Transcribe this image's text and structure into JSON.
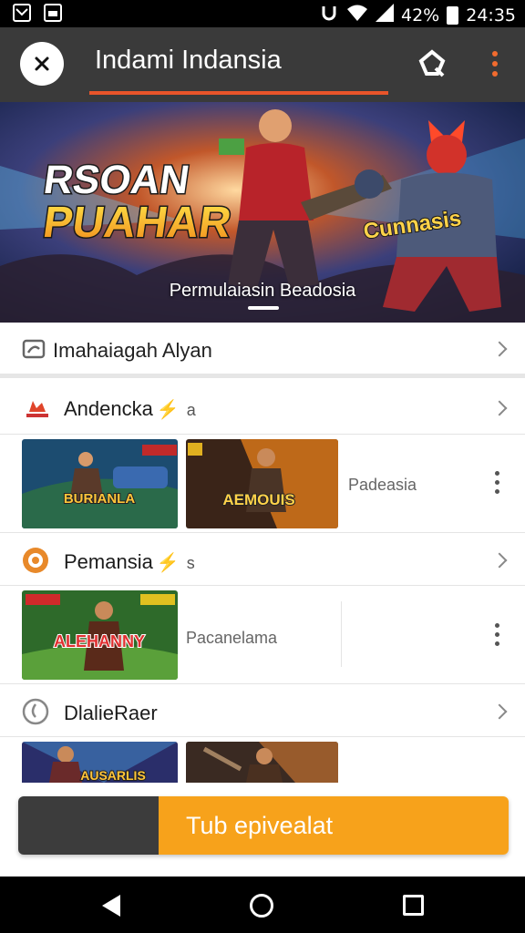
{
  "status_bar": {
    "left_icons": [
      "mail-icon",
      "image-notification-icon"
    ],
    "right_icons": [
      "sync-icon",
      "wifi-icon",
      "signal-icon",
      "battery-icon"
    ],
    "battery": "42%",
    "time": "24:35"
  },
  "app_bar": {
    "title": "Indami Indansia",
    "close_icon": "close-icon",
    "search_icon": "search-icon",
    "more_icon": "more-vertical-icon",
    "accent": "#e8542a"
  },
  "hero": {
    "logo_text_1": "RSOAN",
    "logo_text_2": "PUAHAR",
    "side_text": "Cunnasis",
    "caption": "Permulaiasin Beadosia"
  },
  "first_row": {
    "icon": "gallery-icon",
    "label": "Imahaiagah Alyan"
  },
  "sections": [
    {
      "icon": "fire-icon",
      "title": "Andencka",
      "flag": "⚡",
      "suffix": "a",
      "thumbnails": [
        "BURIANLA",
        "AEMOUIS"
      ],
      "side_text": "Padeasia"
    },
    {
      "icon": "badge-icon",
      "title": "Pemansia",
      "flag": "⚡",
      "suffix": "s",
      "thumbnails": [
        "ALEHANNY"
      ],
      "side_text": "Pacanelama"
    },
    {
      "icon": "history-icon",
      "title": "DlalieRaer",
      "flag": "",
      "suffix": "",
      "thumbnails": [
        "AUSARLIS",
        ""
      ],
      "side_text": ""
    }
  ],
  "action_button": {
    "label": "Tub epivealat",
    "color": "#f7a21b"
  },
  "nav_bar": {
    "icons": [
      "back-icon",
      "home-icon",
      "recents-icon"
    ]
  }
}
